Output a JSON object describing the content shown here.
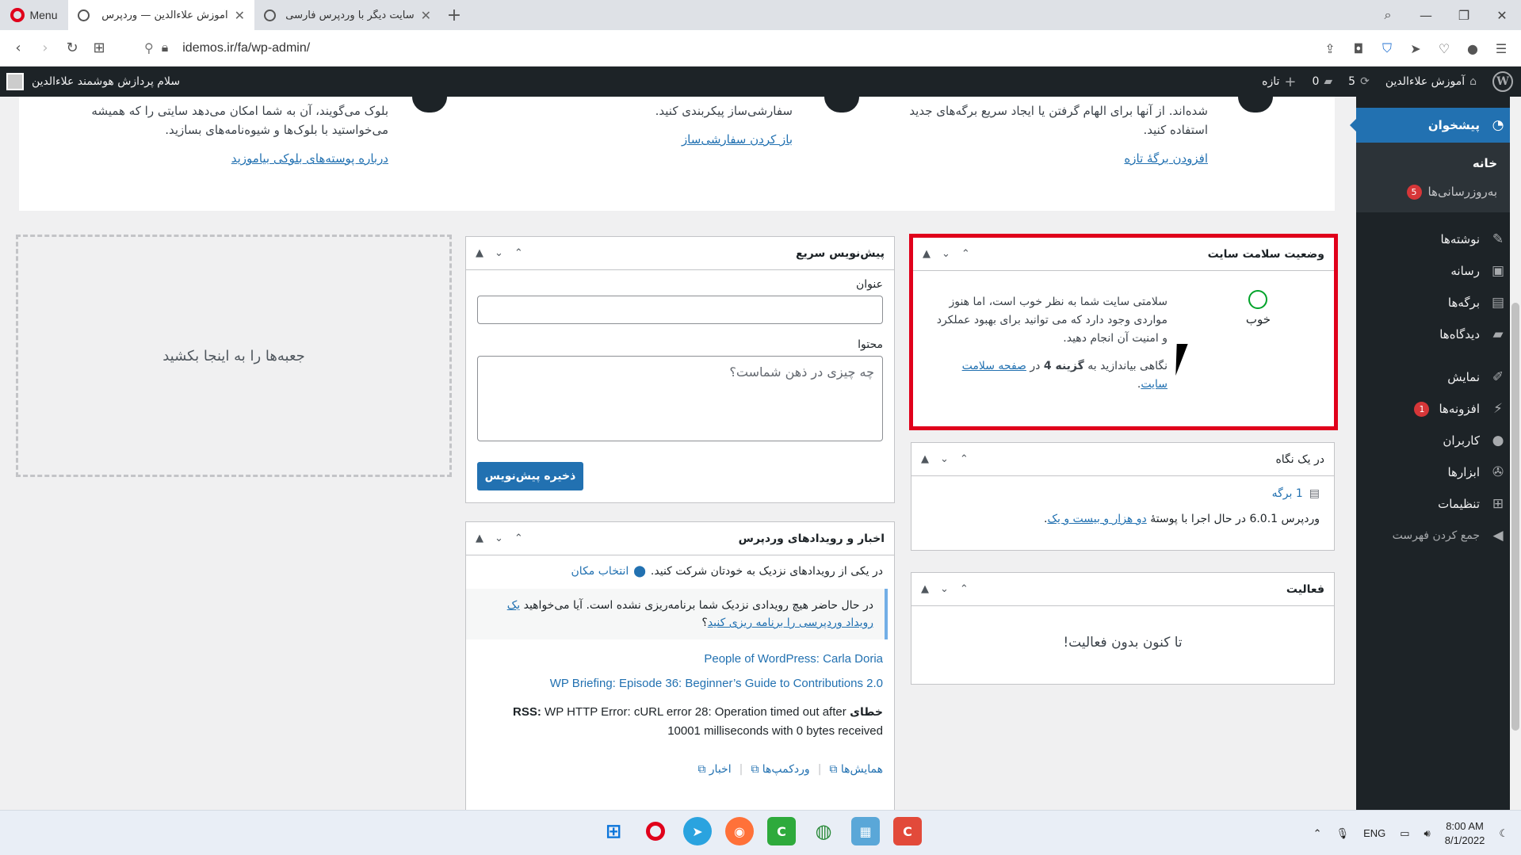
{
  "browser": {
    "menu_label": "Menu",
    "tabs": [
      {
        "title": "آموزش علاءالدین — وردپرس",
        "active": true
      },
      {
        "title": "سایت دیگر با وردپرس فارسی",
        "active": false
      }
    ],
    "url": "idemos.ir/fa/wp-admin/"
  },
  "adminbar": {
    "site_name": "آموزش علاءالدین",
    "updates_count": "5",
    "comments_count": "0",
    "new_label": "تازه",
    "greeting": "سلام پردازش هوشمند علاءالدین"
  },
  "sidebar": {
    "current": "پیشخوان",
    "sub": {
      "home": "خانه",
      "updates": "به‌روزرسانی‌ها",
      "updates_badge": "5"
    },
    "items": [
      {
        "label": "نوشته‌ها",
        "icon": "pin-icon"
      },
      {
        "label": "رسانه",
        "icon": "media-icon"
      },
      {
        "label": "برگه‌ها",
        "icon": "page-icon"
      },
      {
        "label": "دیدگاه‌ها",
        "icon": "comment-icon"
      },
      {
        "label": "نمایش",
        "icon": "brush-icon"
      },
      {
        "label": "افزونه‌ها",
        "icon": "plugin-icon",
        "badge": "1"
      },
      {
        "label": "کاربران",
        "icon": "user-icon"
      },
      {
        "label": "ابزارها",
        "icon": "wrench-icon"
      },
      {
        "label": "تنظیمات",
        "icon": "settings-icon"
      }
    ],
    "collapse": "جمع کردن فهرست"
  },
  "welcome": {
    "col1_text": "شده‌اند. از آنها برای الهام گرفتن یا ایجاد سریع برگه‌های جدید استفاده کنید.",
    "col1_link": "افزودن برگهٔ تازه",
    "col2_text": "سفارشی‌ساز پیکربندی کنید.",
    "col2_link": "باز کردن سفارشی‌ساز",
    "col3_text": "بلوک می‌گویند، آن به شما امکان می‌دهد سایتی را که همیشه می‌خواستید با بلوک‌ها و شیوه‌نامه‌های بسازید.",
    "col3_link": "درباره پوسته‌های بلوکی بیاموزید"
  },
  "health": {
    "title": "وضعیت سلامت سایت",
    "status": "خوب",
    "text": "سلامتی سایت شما به نظر خوب است، اما هنوز مواردی وجود دارد که می توانید برای بهبود عملکرد و امنیت آن انجام دهید.",
    "hint_prefix": "نگاهی بیاندازید به",
    "hint_count": "گزینه 4",
    "hint_mid": "در",
    "hint_link": "صفحه سلامت سایت",
    "hint_end": "."
  },
  "glance": {
    "title": "در یک نگاه",
    "pages": "1 برگه",
    "wp_prefix": "وردپرس 6.0.1 در حال اجرا با پوستهٔ",
    "theme_link": "دو هزار و بیست و یک",
    "wp_suffix": "."
  },
  "activity": {
    "title": "فعالیت",
    "empty": "تا کنون بدون فعالیت!"
  },
  "quickdraft": {
    "title": "پیش‌نویس سریع",
    "title_label": "عنوان",
    "content_label": "محتوا",
    "content_placeholder": "چه چیزی در ذهن شماست؟",
    "save": "ذخیره پیش‌نویس"
  },
  "events": {
    "title": "اخبار و رویدادهای وردپرس",
    "intro": "در یکی از رویدادهای نزدیک به خودتان شرکت کنید.",
    "location_link": "انتخاب مکان",
    "none_text": "در حال حاضر هیچ رویدادی نزدیک شما برنامه‌ریزی نشده است. آیا می‌خواهید",
    "none_link": "یک رویداد وردپرسی را برنامه ریزی کنید",
    "none_end": "؟",
    "news": [
      "People of WordPress: Carla Doria",
      "WP Briefing: Episode 36: Beginner’s Guide to Contributions 2.0"
    ],
    "error_label": "خطای",
    "error_rss": "RSS:",
    "error_text": "WP HTTP Error: cURL error 28: Operation timed out after 10001 milliseconds with 0 bytes received",
    "footer_links": [
      "همایش‌ها",
      "وردکمپ‌ها",
      "اخبار"
    ]
  },
  "dropzone": "جعبه‌ها را به اینجا بکشید",
  "taskbar": {
    "lang": "ENG",
    "time": "8:00 AM",
    "date": "8/1/2022"
  }
}
